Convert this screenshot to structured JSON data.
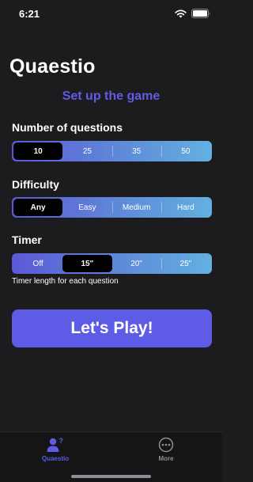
{
  "status_bar": {
    "time": "6:21"
  },
  "app": {
    "title": "Quaestio",
    "subtitle": "Set up the game"
  },
  "questions": {
    "label": "Number of questions",
    "options": [
      "10",
      "25",
      "35",
      "50"
    ],
    "selected": "10"
  },
  "difficulty": {
    "label": "Difficulty",
    "options": [
      "Any",
      "Easy",
      "Medium",
      "Hard"
    ],
    "selected": "Any"
  },
  "timer": {
    "label": "Timer",
    "options": [
      "Off",
      "15\"",
      "20\"",
      "25\""
    ],
    "selected": "15\"",
    "helper": "Timer length for each question"
  },
  "play_button": {
    "label": "Let's Play!"
  },
  "tab_bar": {
    "tabs": [
      {
        "label": "Quaestio",
        "icon": "person-question-icon",
        "active": true
      },
      {
        "label": "More",
        "icon": "ellipsis-circle-icon",
        "active": false
      }
    ]
  },
  "colors": {
    "accent": "#5e5ce6",
    "gradient_start": "#5b58d6",
    "gradient_end": "#63b0e0",
    "inactive_tab": "#8e8e93",
    "background": "#1c1c1e"
  }
}
